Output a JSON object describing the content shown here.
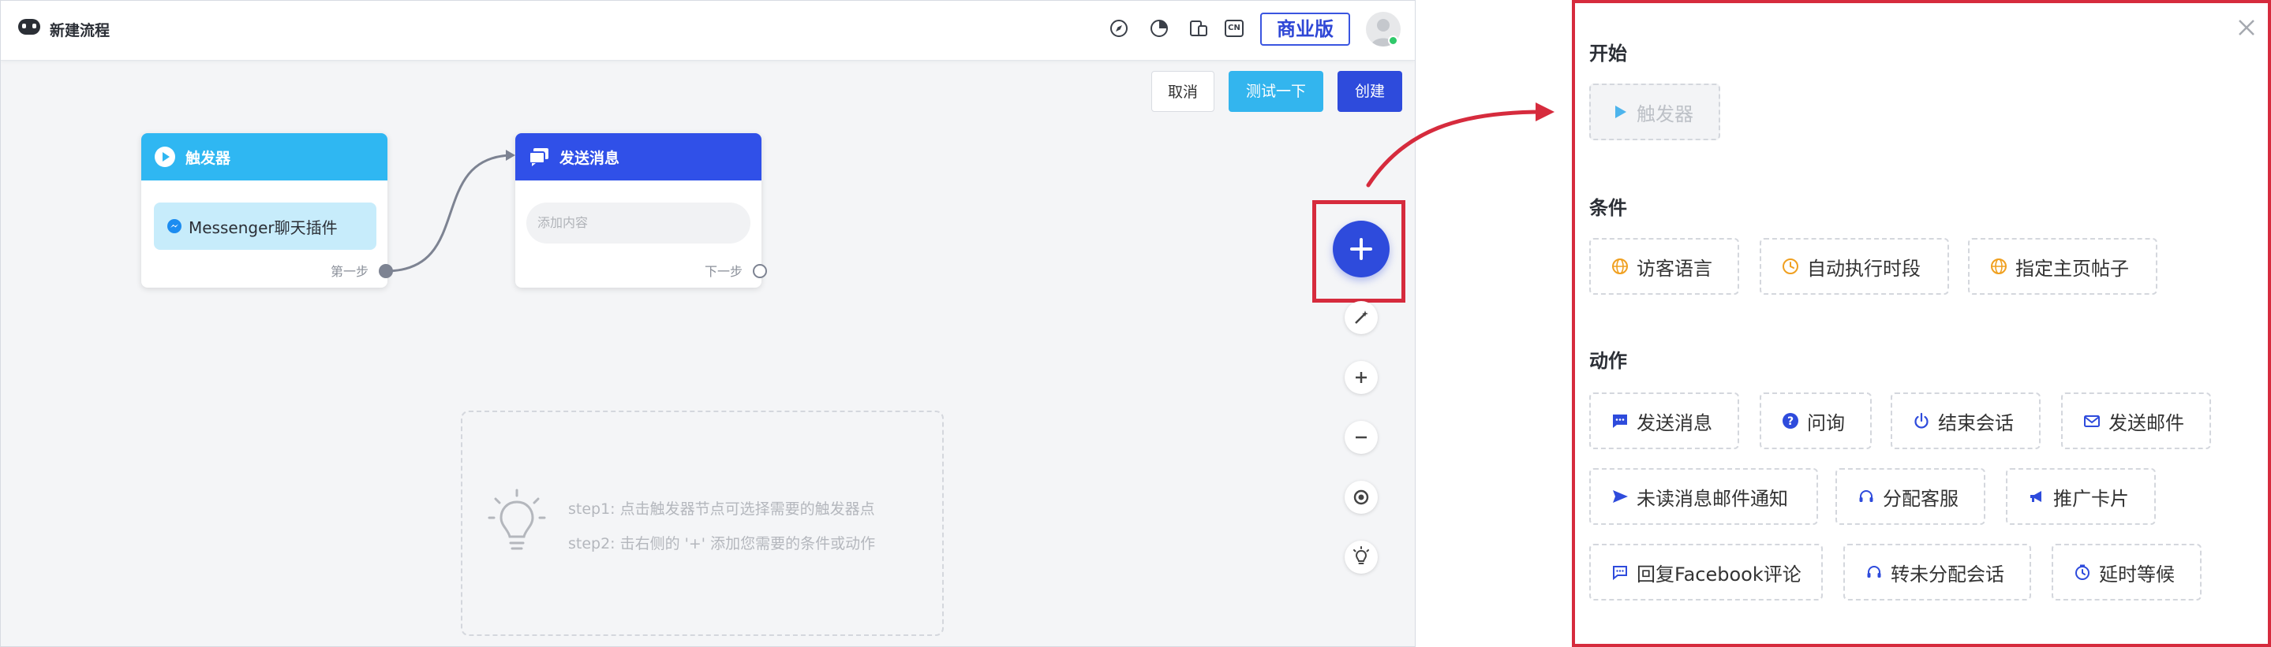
{
  "header": {
    "title": "新建流程",
    "edition_label": "商业版",
    "language_icon_text": "CN"
  },
  "actions": {
    "cancel": "取消",
    "test": "测试一下",
    "create": "创建"
  },
  "nodes": {
    "trigger": {
      "title": "触发器",
      "chip": "Messenger聊天插件",
      "footer": "第一步"
    },
    "send": {
      "title": "发送消息",
      "placeholder": "添加内容",
      "footer": "下一步"
    }
  },
  "tips": {
    "step1": "step1: 点击触发器节点可选择需要的触发器点",
    "step2": "step2: 击右侧的 '+' 添加您需要的条件或动作"
  },
  "panel": {
    "sections": {
      "start": {
        "title": "开始",
        "items": [
          {
            "label": "触发器",
            "icon": "play-icon",
            "disabled": true
          }
        ]
      },
      "conditions": {
        "title": "条件",
        "items": [
          {
            "label": "访客语言",
            "icon": "globe-icon"
          },
          {
            "label": "自动执行时段",
            "icon": "clock-icon"
          },
          {
            "label": "指定主页帖子",
            "icon": "globe-icon"
          }
        ]
      },
      "actions": {
        "title": "动作",
        "items": [
          {
            "label": "发送消息",
            "icon": "message-icon"
          },
          {
            "label": "问询",
            "icon": "question-icon"
          },
          {
            "label": "结束会话",
            "icon": "power-icon"
          },
          {
            "label": "发送邮件",
            "icon": "mail-icon"
          },
          {
            "label": "未读消息邮件通知",
            "icon": "send-icon"
          },
          {
            "label": "分配客服",
            "icon": "headset-icon"
          },
          {
            "label": "推广卡片",
            "icon": "megaphone-icon"
          },
          {
            "label": "回复Facebook评论",
            "icon": "comment-icon"
          },
          {
            "label": "转未分配会话",
            "icon": "headset-icon"
          },
          {
            "label": "延时等候",
            "icon": "timer-icon"
          }
        ]
      }
    }
  },
  "colors": {
    "primary": "#2e4bdc",
    "trigger": "#2fb7f2",
    "highlight": "#d62b3d",
    "condition_icon": "#f0a020"
  }
}
